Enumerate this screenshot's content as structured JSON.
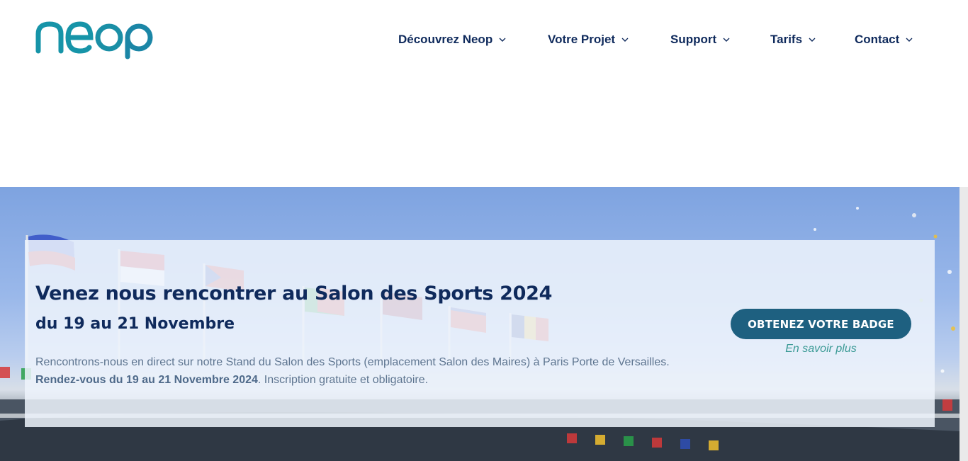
{
  "logo": {
    "text": "neop",
    "color": "#1a9aa0"
  },
  "nav": {
    "items": [
      {
        "label": "Découvrez Neop",
        "icon": "chevron-down-icon"
      },
      {
        "label": "Votre Projet",
        "icon": "chevron-down-icon"
      },
      {
        "label": "Support",
        "icon": "chevron-down-icon"
      },
      {
        "label": "Tarifs",
        "icon": "chevron-down-icon"
      },
      {
        "label": "Contact",
        "icon": "chevron-down-icon"
      }
    ]
  },
  "hero": {
    "title": "Venez nous rencontrer au Salon des Sports 2024",
    "subtitle": "du 19 au 21 Novembre",
    "body_prefix": "Rencontrons-nous en direct sur notre Stand du Salon des Sports (emplacement Salon des Maires) à Paris Porte de Versailles. ",
    "body_strong": "Rendez-vous du 19 au 21 Novembre 2024",
    "body_suffix": ". Inscription gratuite et obligatoire.",
    "cta_label": "OBTENEZ VOTRE BADGE",
    "more_label": "En savoir plus"
  },
  "colors": {
    "nav_text": "#0f2a5c",
    "cta_background": "#1e6080",
    "link": "#3a9a95"
  }
}
